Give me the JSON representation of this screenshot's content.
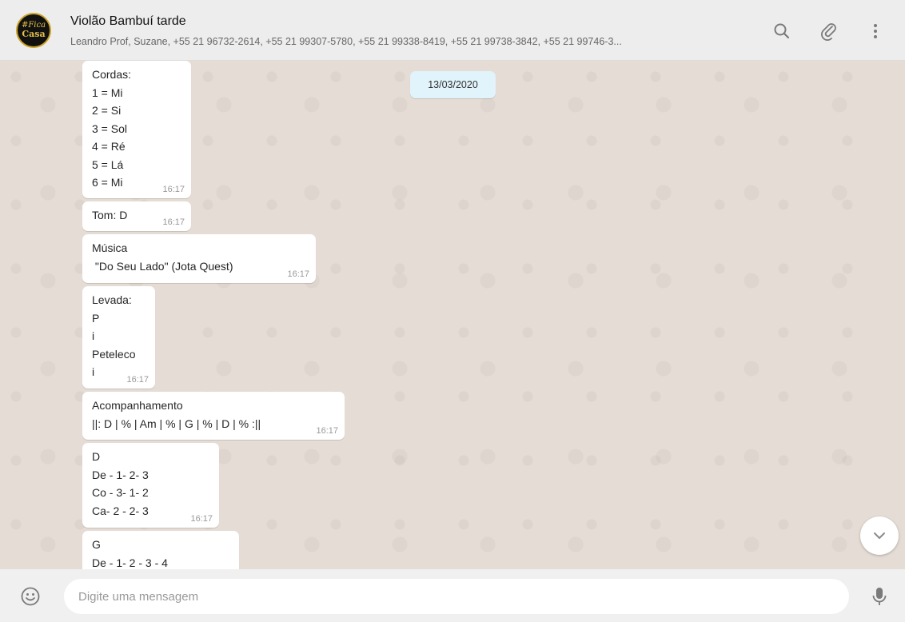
{
  "header": {
    "avatar_line1": "#Fica",
    "avatar_line2": "Casa",
    "title": "Violão Bambuí tarde",
    "members": "Leandro Prof, Suzane, +55 21 96732-2614, +55 21 99307-5780, +55 21 99338-8419, +55 21 99738-3842, +55 21 99746-3..."
  },
  "chat": {
    "date": "13/03/2020",
    "messages": [
      {
        "lines": [
          "Cordas:",
          "1 = Mi",
          "2 = Si",
          "3 = Sol",
          "4 = Ré",
          "5 = Lá",
          "6 = Mi"
        ],
        "time": "16:17"
      },
      {
        "lines": [
          "Tom: D"
        ],
        "time": "16:17"
      },
      {
        "lines": [
          "Música",
          " \"Do Seu Lado\" (Jota Quest)"
        ],
        "time": "16:17"
      },
      {
        "lines": [
          "Levada:",
          "P",
          "i",
          "Peteleco",
          "i"
        ],
        "time": "16:17"
      },
      {
        "lines": [
          "Acompanhamento",
          "||: D | % | Am | % | G | % | D | % :||"
        ],
        "time": "16:17"
      },
      {
        "lines": [
          "D",
          "De - 1- 2- 3",
          "Co - 3- 1- 2",
          "Ca- 2 - 2- 3"
        ],
        "time": "16:17"
      },
      {
        "lines": [
          "G",
          "De - 1- 2 - 3 - 4"
        ],
        "time": ""
      }
    ]
  },
  "composer": {
    "placeholder": "Digite uma mensagem"
  },
  "icons": {
    "search": "search-icon",
    "attach": "paperclip-icon",
    "menu": "more-vertical-icon",
    "scroll": "chevron-down-icon",
    "emoji": "emoji-icon",
    "mic": "microphone-icon"
  },
  "colors": {
    "chat_background": "#e5ddd5",
    "date_pill": "#e1f3fb",
    "header_background": "#ededed"
  }
}
